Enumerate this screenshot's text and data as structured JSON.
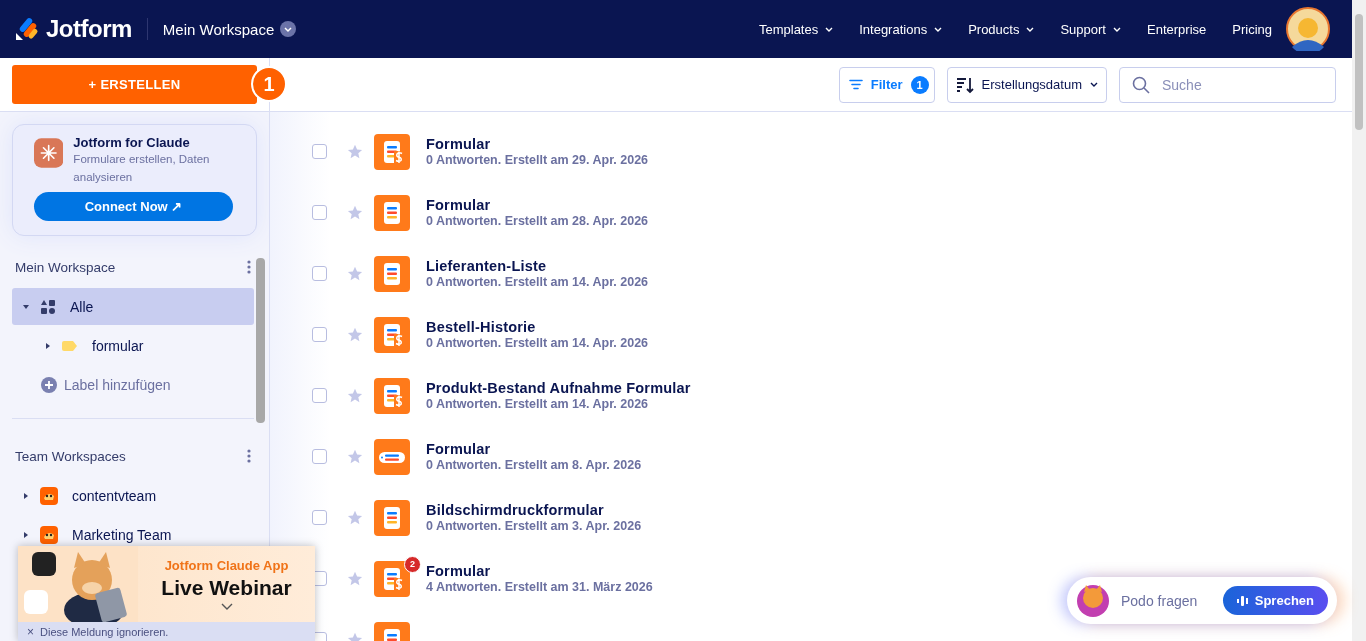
{
  "header": {
    "logo": "Jotform",
    "workspace": "Mein Workspace",
    "nav": [
      {
        "label": "Templates",
        "dropdown": true
      },
      {
        "label": "Integrations",
        "dropdown": true
      },
      {
        "label": "Products",
        "dropdown": true
      },
      {
        "label": "Support",
        "dropdown": true
      },
      {
        "label": "Enterprise",
        "dropdown": false
      },
      {
        "label": "Pricing",
        "dropdown": false
      }
    ]
  },
  "create_button": {
    "label": "+ ERSTELLEN",
    "step": "1"
  },
  "promo": {
    "title": "Jotform for Claude",
    "text": "Formulare erstellen, Daten analysieren",
    "button": "Connect Now ↗"
  },
  "sidebar": [
    {
      "title": "Mein Workspace",
      "items": [
        {
          "label": "Alle",
          "kind": "all",
          "expanded": true,
          "selected": true,
          "children": [
            {
              "label": "formular",
              "kind": "label",
              "expanded": false,
              "selected": false
            }
          ]
        }
      ],
      "add_label": "Label hinzufügen"
    },
    {
      "title": "Team Workspaces",
      "items": [
        {
          "label": "contentvteam",
          "kind": "team",
          "expanded": false,
          "selected": false
        },
        {
          "label": "Marketing Team",
          "kind": "team",
          "expanded": false,
          "selected": false
        }
      ]
    }
  ],
  "toolbar": {
    "filter": {
      "label": "Filter",
      "count": "1"
    },
    "sort": "Erstellungsdatum",
    "search": {
      "placeholder": "Suche"
    }
  },
  "forms": [
    {
      "title": "Formular",
      "meta": "0 Antworten. Erstellt am 29. Apr. 2026",
      "kind": "payment",
      "checked": false,
      "starred": false
    },
    {
      "title": "Formular",
      "meta": "0 Antworten. Erstellt am 28. Apr. 2026",
      "kind": "form",
      "checked": false,
      "starred": false
    },
    {
      "title": "Lieferanten-Liste",
      "meta": "0 Antworten. Erstellt am 14. Apr. 2026",
      "kind": "form",
      "checked": false,
      "starred": false
    },
    {
      "title": "Bestell-Historie",
      "meta": "0 Antworten. Erstellt am 14. Apr. 2026",
      "kind": "payment",
      "checked": false,
      "starred": false
    },
    {
      "title": "Produkt-Bestand Aufnahme Formular",
      "meta": "0 Antworten. Erstellt am 14. Apr. 2026",
      "kind": "payment",
      "checked": false,
      "starred": false
    },
    {
      "title": "Formular",
      "meta": "0 Antworten. Erstellt am 8. Apr. 2026",
      "kind": "card",
      "checked": false,
      "starred": false
    },
    {
      "title": "Bildschirmdruckformular",
      "meta": "0 Antworten. Erstellt am 3. Apr. 2026",
      "kind": "form",
      "checked": false,
      "starred": false
    },
    {
      "title": "Formular",
      "meta": "4 Antworten. Erstellt am 31. März 2026",
      "kind": "payment",
      "badge": "2",
      "checked": false,
      "starred": false
    },
    {
      "kind": "form",
      "checked": false,
      "starred": false
    }
  ],
  "webinar": {
    "eyebrow": "Jotform Claude App",
    "title": "Live Webinar",
    "close": "×",
    "dismiss": "Diese Meldung ignorieren."
  },
  "assistant": {
    "placeholder": "Podo fragen",
    "button": "Sprechen"
  }
}
